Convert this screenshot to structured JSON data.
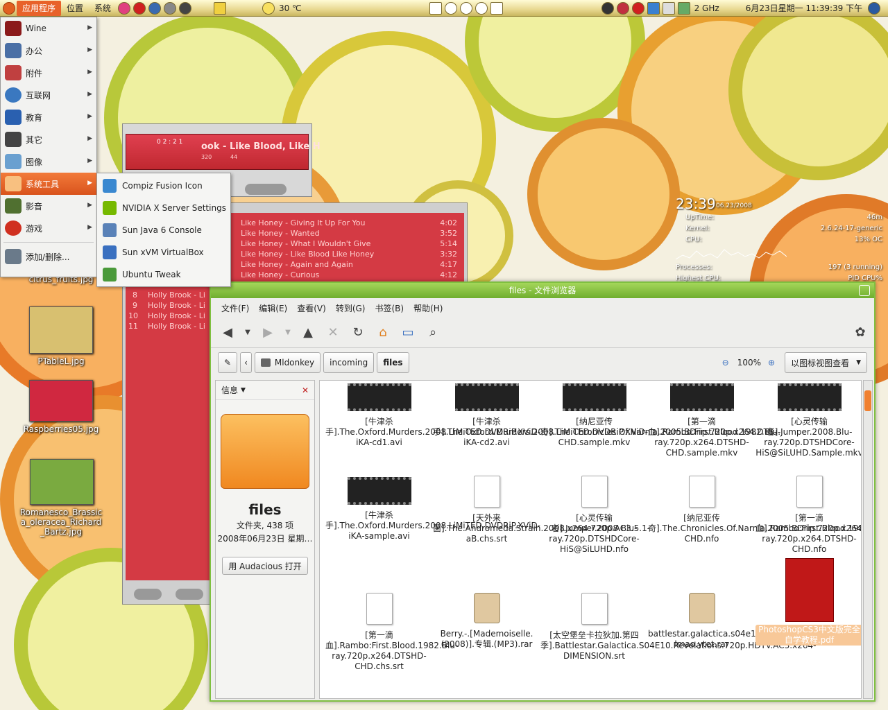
{
  "panel": {
    "menus": [
      "应用程序",
      "位置",
      "系统"
    ],
    "weather": "30 ℃",
    "cpu_freq": "2 GHz",
    "clock": "6月23日星期一 11:39:39 下午"
  },
  "app_menu": {
    "items": [
      {
        "label": "Wine",
        "icon": "wine-icon",
        "color": "#8b1a1a"
      },
      {
        "label": "办公",
        "icon": "office-icon",
        "color": "#4a6fa5"
      },
      {
        "label": "附件",
        "icon": "accessories-icon",
        "color": "#c04040"
      },
      {
        "label": "互联网",
        "icon": "internet-icon",
        "color": "#3a78c0"
      },
      {
        "label": "教育",
        "icon": "education-icon",
        "color": "#2a60b0"
      },
      {
        "label": "其它",
        "icon": "other-icon",
        "color": "#444444"
      },
      {
        "label": "图像",
        "icon": "graphics-icon",
        "color": "#6aa0d0"
      },
      {
        "label": "系统工具",
        "icon": "system-tools-icon",
        "color": "#e06020"
      },
      {
        "label": "影音",
        "icon": "multimedia-icon",
        "color": "#507030"
      },
      {
        "label": "游戏",
        "icon": "games-icon",
        "color": "#d03020"
      }
    ],
    "add_remove": "添加/删除..."
  },
  "submenu": {
    "items": [
      {
        "label": "Compiz Fusion Icon",
        "icon": "compiz-icon",
        "color": "#3a88d0"
      },
      {
        "label": "NVIDIA X Server Settings",
        "icon": "nvidia-icon",
        "color": "#76b900"
      },
      {
        "label": "Sun Java 6 Console",
        "icon": "java-icon",
        "color": "#5a82b8"
      },
      {
        "label": "Sun xVM VirtualBox",
        "icon": "virtualbox-icon",
        "color": "#3a70c0"
      },
      {
        "label": "Ubuntu Tweak",
        "icon": "ubuntu-tweak-icon",
        "color": "#4a9a3a"
      }
    ]
  },
  "desktop": {
    "icons": [
      {
        "label": "citrus_fruits.jpg",
        "color": "#ffffff"
      },
      {
        "label": "PTableL.jpg",
        "color": "#d8c070"
      },
      {
        "label": "Raspberries05.jpg",
        "color": "#d02840"
      },
      {
        "label": "Romanesco_Brassica_oleracea_Richard_Bartz.jpg",
        "color": "#7aaa40"
      }
    ]
  },
  "audacious": {
    "time": "0 2 : 2 1",
    "title": "ook - Like Blood, Like H",
    "kbps": "320",
    "khz": "44",
    "playlist": [
      {
        "text": "Like Honey - Giving It Up For You",
        "time": "4:02"
      },
      {
        "text": "Like Honey - Wanted",
        "time": "3:52"
      },
      {
        "text": "Like Honey - What I Wouldn't Give",
        "time": "5:14"
      },
      {
        "text": "Like Honey - Like Blood Like Honey",
        "time": "3:32"
      },
      {
        "text": "Like Honey - Again and Again",
        "time": "4:17"
      },
      {
        "text": "Like Honey - Curious",
        "time": "4:12"
      }
    ],
    "playlist_more": [
      {
        "num": "8",
        "text": "Holly Brook - Li"
      },
      {
        "num": "9",
        "text": "Holly Brook - Li"
      },
      {
        "num": "10",
        "text": "Holly Brook - Li"
      },
      {
        "num": "11",
        "text": "Holly Brook - Li"
      }
    ]
  },
  "conky": {
    "time": "23:39",
    "date": "06.23/2008",
    "uptime_label": "UpTime:",
    "uptime_val": "46m",
    "kernel_label": "Kernel:",
    "kernel_val": "2.6.24-17-generic",
    "cpu_label": "CPU:",
    "cpu_val": "13% OC",
    "processes_label": "Processes:",
    "processes_val": "197 (3 running)",
    "highest_label": "Highest CPU:",
    "highest_val": "PID CPU%"
  },
  "fb": {
    "title": "files - 文件浏览器",
    "menu": [
      "文件(F)",
      "编辑(E)",
      "查看(V)",
      "转到(G)",
      "书签(B)",
      "帮助(H)"
    ],
    "path": [
      "Mldonkey",
      "incoming",
      "files"
    ],
    "zoom": "100%",
    "view_mode": "以图标视图查看",
    "side": {
      "header": "信息",
      "folder_name": "files",
      "folder_info": "文件夹, 438 项",
      "folder_date": "2008年06月23日 星期…",
      "open_with": "用 Audacious 打开"
    },
    "files": [
      {
        "name": "[牛津杀手].The.Oxford.Murders.2008.LiMiTED.DVDRiP.XViD-iKA-cd1.avi",
        "type": "video"
      },
      {
        "name": "[牛津杀手].The.Oxford.Murders.2008.LiMiTED.DVDRiP.XViD-iKA-cd2.avi",
        "type": "video"
      },
      {
        "name": "[纳尼亚传奇].The.Chronicles.Of.Narnia.2005.BDrip.720p.x264.DTS-CHD.sample.mkv",
        "type": "video"
      },
      {
        "name": "[第一滴血].Rambo:First.Blood.1982.Blu-ray.720p.x264.DTSHD-CHD.sample.mkv",
        "type": "video"
      },
      {
        "name": "[心灵传输者].Jumper.2008.Blu-ray.720p.DTSHDCore-HiS@SiLUHD.Sample.mkv",
        "type": "video"
      },
      {
        "name": "[牛津杀手].The.Oxford.Murders.2008.LiMiTED.DVDRiP.XViD-iKA-sample.avi",
        "type": "video"
      },
      {
        "name": "[天外来菌].The.Andromeda.Strain.2008.x264.720p.AC3.5.1-aB.chs.srt",
        "type": "doc"
      },
      {
        "name": "[心灵传输者].Jumper.2008.Blu-ray.720p.DTSHDCore-HiS@SiLUHD.nfo",
        "type": "doc"
      },
      {
        "name": "[纳尼亚传奇].The.Chronicles.Of.Narnia.2005.BDrip.720p.x264.DTS-CHD.nfo",
        "type": "doc"
      },
      {
        "name": "[第一滴血].Rambo:First.Blood.1982.Blu-ray.720p.x264.DTSHD-CHD.nfo",
        "type": "doc"
      },
      {
        "name": "[第一滴血].Rambo:First.Blood.1982.Blu-ray.720p.x264.DTSHD-CHD.chs.srt",
        "type": "doc"
      },
      {
        "name": "Berry.-.[Mademoiselle.(2008)].专辑.(MP3).rar",
        "type": "box"
      },
      {
        "name": "[太空堡垒卡拉狄加.第四季].Battlestar.Galactica.S04E10.Revelations.720p.HDTV.AC3.x264-DIMENSION.srt",
        "type": "doc"
      },
      {
        "name": "battlestar.galactica.s04e10.hdtv.xvid-lmao.ytet.rar",
        "type": "box"
      },
      {
        "name": "PhotoshopCS3中文版完全自学教程.pdf",
        "type": "pdf"
      }
    ]
  }
}
